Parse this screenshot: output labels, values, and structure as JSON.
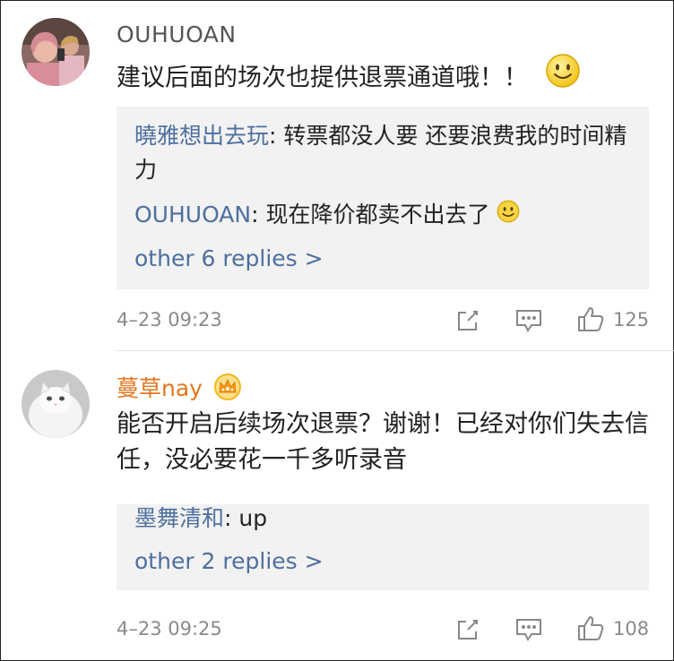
{
  "comments": [
    {
      "username": "OUHUOAN",
      "text": "建议后面的场次也提供退票通道哦！！",
      "emoji": "smiley-emoji",
      "replies": [
        {
          "author": "曉雅想出去玩",
          "separator": ": ",
          "text": "转票都没人要 还要浪费我的时间精力"
        },
        {
          "author": "OUHUOAN",
          "separator": ": ",
          "text": "现在降价都卖不出去了",
          "emoji": "smiley-emoji"
        }
      ],
      "more_replies": "other 6 replies >",
      "timestamp": "4–23 09:23",
      "like_count": "125"
    },
    {
      "username": "蔓草nay",
      "badge": "crown-icon",
      "text": "能否开启后续场次退票？谢谢！已经对你们失去信任，没必要花一千多听录音",
      "replies": [
        {
          "author": "墨舞清和",
          "separator": ": ",
          "text": "up"
        }
      ],
      "more_replies": "other 2 replies >",
      "timestamp": "4–23 09:25",
      "like_count": "108"
    }
  ],
  "colors": {
    "link": "#4e6f9f",
    "vip_name": "#e2761e",
    "reply_bg": "#f2f2f2",
    "meta": "#8a8a8a"
  },
  "icons": {
    "share": "share-icon",
    "comment": "comment-icon",
    "like": "thumbs-up-icon"
  }
}
